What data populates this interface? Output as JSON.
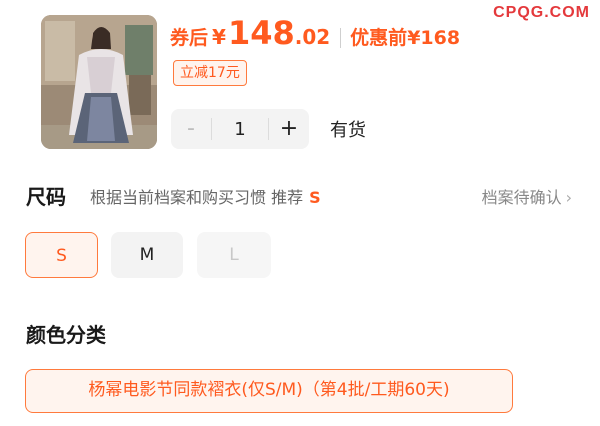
{
  "watermark": "CPQG.COM",
  "product": {
    "price_label": "券后",
    "currency": "¥",
    "price_integer": "148",
    "price_decimal": ".02",
    "original_label": "优惠前",
    "original_price": "¥168",
    "coupon": "立减17元"
  },
  "quantity": {
    "minus": "-",
    "value": "1",
    "plus": "+",
    "stock": "有货"
  },
  "size": {
    "title": "尺码",
    "hint": "根据当前档案和购买习惯 推荐",
    "recommended": "S",
    "archive_link": "档案待确认",
    "chevron": "›",
    "options": [
      {
        "label": "S",
        "state": "selected"
      },
      {
        "label": "M",
        "state": "available"
      },
      {
        "label": "L",
        "state": "disabled"
      }
    ]
  },
  "color": {
    "title": "颜色分类",
    "options": [
      {
        "label": "杨幂电影节同款褶衣(仅S/M)（第4批/工期60天)",
        "state": "selected"
      }
    ]
  },
  "colors": {
    "accent": "#ff5a1f",
    "accent_border": "#ff7a3d",
    "chip_bg": "#f3f3f3"
  }
}
